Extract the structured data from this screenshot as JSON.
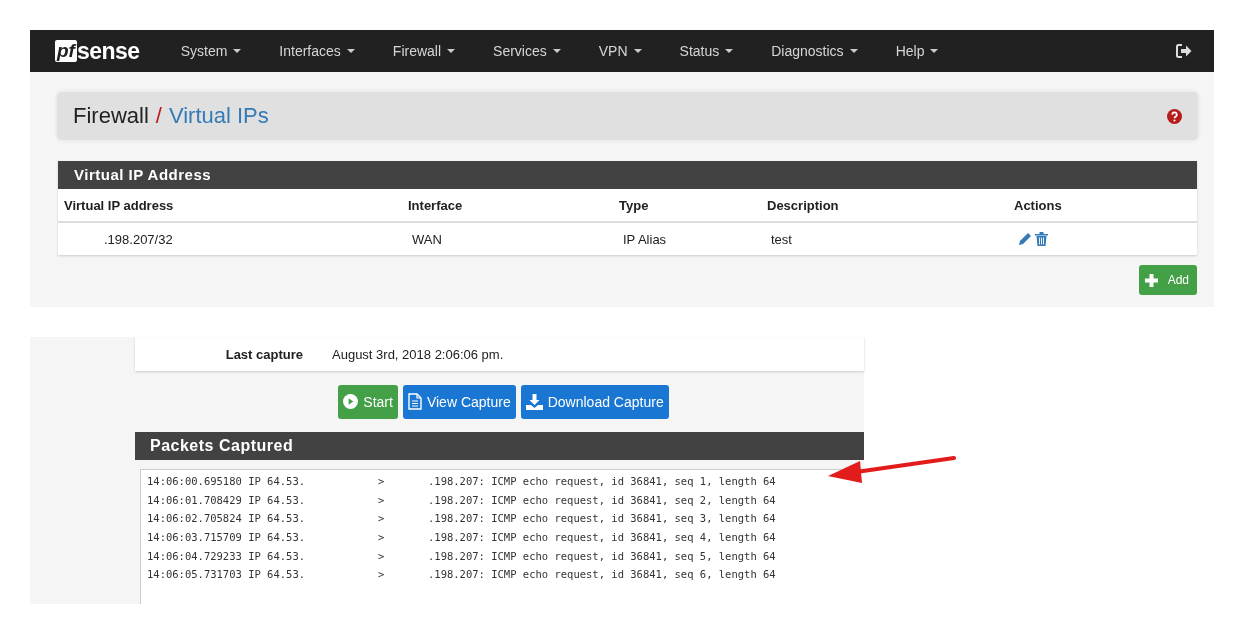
{
  "navbar": {
    "brand": "sense",
    "brand_mark": "pf",
    "menu": [
      {
        "label": "System"
      },
      {
        "label": "Interfaces"
      },
      {
        "label": "Firewall"
      },
      {
        "label": "Services"
      },
      {
        "label": "VPN"
      },
      {
        "label": "Status"
      },
      {
        "label": "Diagnostics"
      },
      {
        "label": "Help"
      }
    ]
  },
  "breadcrumb": {
    "parent": "Firewall",
    "separator": "/",
    "current": "Virtual IPs"
  },
  "vip_panel": {
    "title": "Virtual IP Address",
    "columns": [
      "Virtual IP address",
      "Interface",
      "Type",
      "Description",
      "Actions"
    ],
    "rows": [
      {
        "address": ".198.207/32",
        "interface": "WAN",
        "type": "IP Alias",
        "description": "test"
      }
    ],
    "add_button": "Add"
  },
  "capture": {
    "last_capture_label": "Last capture",
    "last_capture_value": "August 3rd, 2018 2:06:06 pm.",
    "buttons": [
      {
        "kind": "start",
        "label": "Start"
      },
      {
        "kind": "view",
        "label": "View Capture"
      },
      {
        "kind": "download",
        "label": "Download Capture"
      }
    ],
    "packets_title": "Packets Captured",
    "packets": [
      {
        "source": "14:06:00.695180 IP 64.53.",
        "arrow": ">",
        "destination": ".198.207: ICMP echo request, id 36841, seq 1, length 64"
      },
      {
        "source": "14:06:01.708429 IP 64.53.",
        "arrow": ">",
        "destination": ".198.207: ICMP echo request, id 36841, seq 2, length 64"
      },
      {
        "source": "14:06:02.705824 IP 64.53.",
        "arrow": ">",
        "destination": ".198.207: ICMP echo request, id 36841, seq 3, length 64"
      },
      {
        "source": "14:06:03.715709 IP 64.53.",
        "arrow": ">",
        "destination": ".198.207: ICMP echo request, id 36841, seq 4, length 64"
      },
      {
        "source": "14:06:04.729233 IP 64.53.",
        "arrow": ">",
        "destination": ".198.207: ICMP echo request, id 36841, seq 5, length 64"
      },
      {
        "source": "14:06:05.731703 IP 64.53.",
        "arrow": ">",
        "destination": ".198.207: ICMP echo request, id 36841, seq 6, length 64"
      }
    ]
  }
}
